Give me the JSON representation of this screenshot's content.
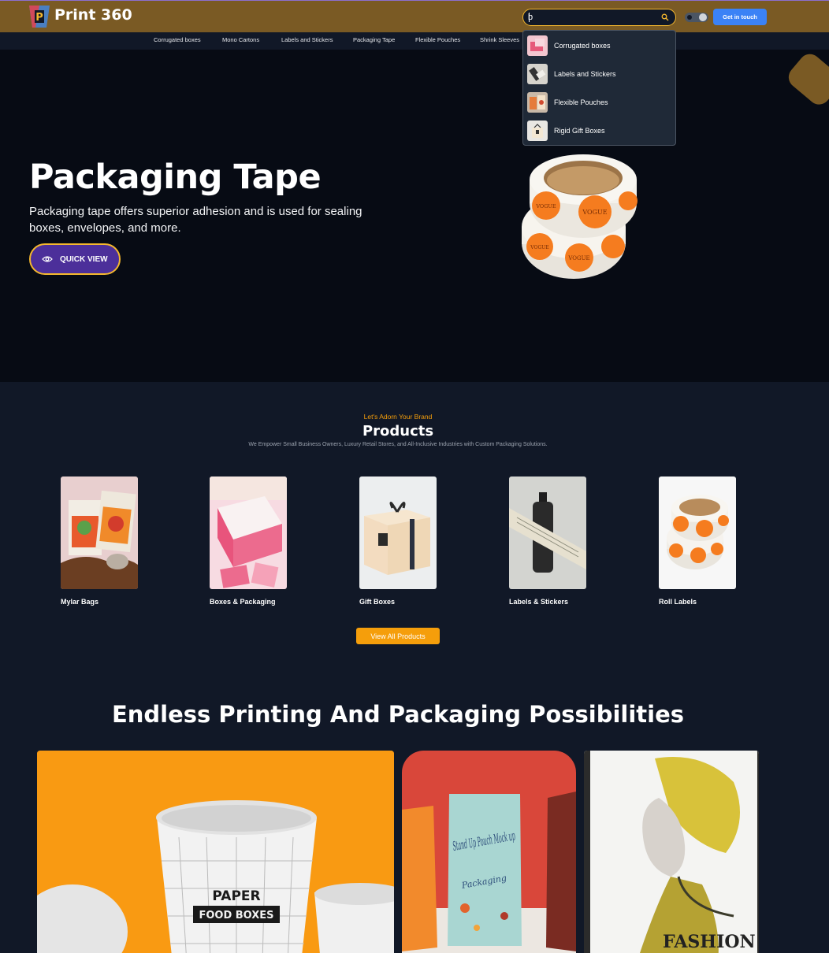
{
  "header": {
    "brand": "Print 360",
    "search_value": "b",
    "cta_label": "Get in touch"
  },
  "categories": [
    "Corrugated boxes",
    "Mono Cartons",
    "Labels and Stickers",
    "Packaging Tape",
    "Flexible Pouches",
    "Shrink Sleeves"
  ],
  "search_results": [
    "Corrugated boxes",
    "Labels and Stickers",
    "Flexible Pouches",
    "Rigid Gift Boxes"
  ],
  "hero": {
    "title": "Packaging Tape",
    "description": "Packaging tape offers superior adhesion and is used for sealing boxes, envelopes, and more.",
    "button": "QUICK VIEW",
    "tape_print": "VOGUE"
  },
  "products": {
    "eyebrow": "Let's Adorn Your Brand",
    "title": "Products",
    "subtitle": "We Empower Small Business Owners, Luxury Retail Stores, and All-Inclusive Industries with Custom Packaging Solutions.",
    "items": [
      "Mylar Bags",
      "Boxes & Packaging",
      "Gift Boxes",
      "Labels & Stickers",
      "Roll Labels"
    ],
    "view_all": "View All Products"
  },
  "possibilities": {
    "title": "Endless Printing And Packaging Possibilities",
    "cup_print_1": "PAPER",
    "cup_print_2": "FOOD BOXES",
    "pouch_print": "Stand Up Pouch Mock up",
    "pouch_sub": "Packaging",
    "magazine_print": "FASHION"
  },
  "colors": {
    "header_bg": "#7a5a24",
    "accent_orange": "#f59e0b",
    "accent_blue": "#3b82f6",
    "accent_purple": "#4c2f9a",
    "border_yellow": "#f5b82e"
  }
}
